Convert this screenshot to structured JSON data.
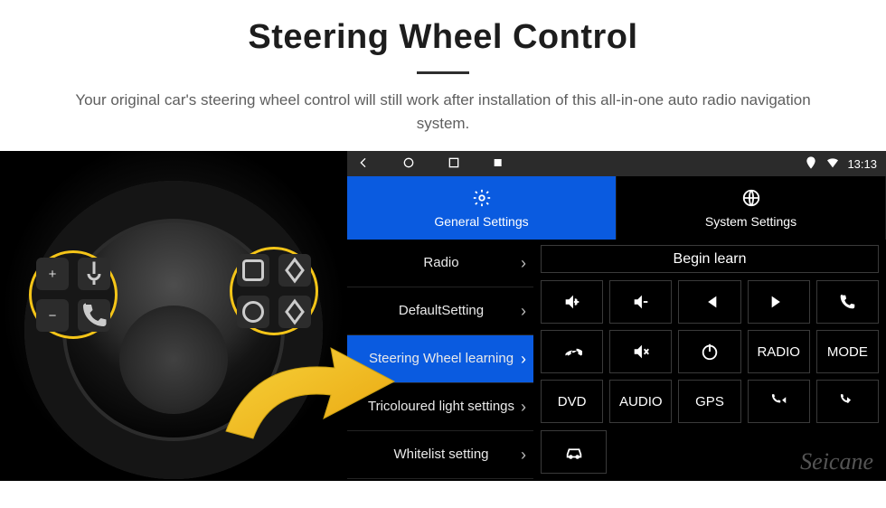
{
  "hero": {
    "title": "Steering Wheel Control",
    "subtitle": "Your original car's steering wheel control will still work after installation of this all-in-one auto radio navigation system."
  },
  "statusbar": {
    "time": "13:13",
    "icons": {
      "back": "back-arrow-icon",
      "home": "circle-icon",
      "recent": "square-icon",
      "vol": "volume-icon"
    },
    "status": {
      "gps": "gps-icon",
      "wifi": "wifi-icon"
    }
  },
  "tabs": {
    "general": {
      "label": "General Settings",
      "icon": "gear-icon"
    },
    "system": {
      "label": "System Settings",
      "icon": "globe-icon"
    }
  },
  "sidebar": {
    "items": [
      {
        "label": "Radio"
      },
      {
        "label": "DefaultSetting"
      },
      {
        "label": "Steering Wheel learning"
      },
      {
        "label": "Tricoloured light settings"
      },
      {
        "label": "Whitelist setting"
      }
    ],
    "selected_index": 2
  },
  "main": {
    "begin_label": "Begin learn",
    "buttons": {
      "vol_up": "vol-up-icon",
      "vol_down": "vol-down-icon",
      "prev": "prev-track-icon",
      "next": "next-track-icon",
      "call": "phone-icon",
      "hangup": "hangup-icon",
      "mute": "mute-icon",
      "power": "power-icon",
      "radio": "RADIO",
      "mode": "MODE",
      "dvd": "DVD",
      "audio": "AUDIO",
      "gps": "GPS",
      "call_prev": "phone-prev-icon",
      "call_next": "phone-next-icon",
      "car": "car-icon"
    }
  },
  "watermark": "Seicane",
  "colors": {
    "accent": "#0a5be0",
    "highlight": "#f5c518"
  }
}
